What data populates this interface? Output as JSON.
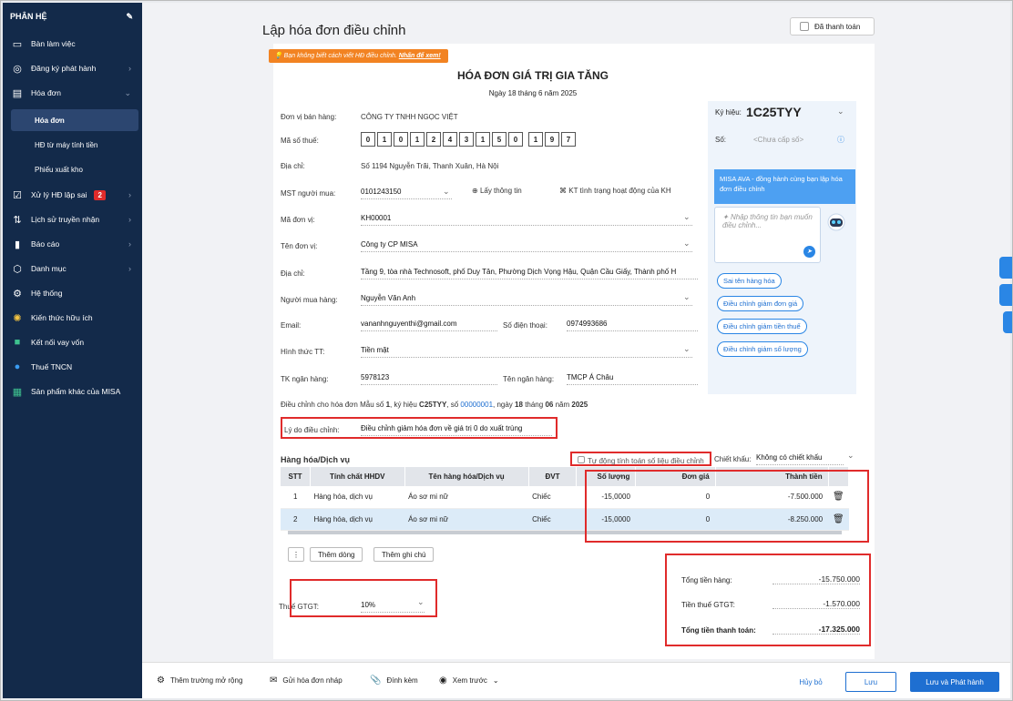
{
  "sidebar": {
    "header": "PHÂN HỆ",
    "items": [
      {
        "label": "Bàn làm việc",
        "icon": "desk-icon"
      },
      {
        "label": "Đăng ký phát hành",
        "icon": "register-icon"
      },
      {
        "label": "Hóa đơn",
        "icon": "invoice-icon"
      },
      {
        "label": "Hóa đơn",
        "icon": ""
      },
      {
        "label": "HĐ từ máy tính tiền",
        "icon": ""
      },
      {
        "label": "Phiếu xuất kho",
        "icon": ""
      },
      {
        "label": "Xử lý HĐ lập sai",
        "icon": "fix-icon",
        "badge": "2"
      },
      {
        "label": "Lịch sử truyền nhận",
        "icon": "history-icon"
      },
      {
        "label": "Báo cáo",
        "icon": "report-icon"
      },
      {
        "label": "Danh mục",
        "icon": "category-icon"
      },
      {
        "label": "Hệ thống",
        "icon": "settings-icon"
      },
      {
        "label": "Kiến thức hữu ích",
        "icon": "bulb-icon"
      },
      {
        "label": "Kết nối vay vốn",
        "icon": "loan-icon"
      },
      {
        "label": "Thuế TNCN",
        "icon": "tax-icon"
      },
      {
        "label": "Sản phẩm khác của MISA",
        "icon": "apps-icon"
      }
    ]
  },
  "header": {
    "title": "Lập hóa đơn điều chỉnh",
    "paid_label": "Đã thanh toán"
  },
  "tip": {
    "text": "Bạn không biết cách viết HĐ điều chỉnh.",
    "link": "Nhấn để xem!"
  },
  "doc": {
    "title": "HÓA ĐƠN GIÁ TRỊ GIA TĂNG",
    "date": "Ngày 18 tháng 6 năm 2025"
  },
  "seller": {
    "unit_label": "Đơn vị bán hàng:",
    "unit": "CÔNG TY TNHH NGỌC VIỆT",
    "tax_label": "Mã số thuế:",
    "tax_digits": [
      "0",
      "1",
      "0",
      "1",
      "2",
      "4",
      "3",
      "1",
      "5",
      "0",
      "1",
      "9",
      "7"
    ],
    "addr_label": "Địa chỉ:",
    "addr": "Số 1194 Nguyễn Trãi, Thanh Xuân, Hà Nội"
  },
  "buyer": {
    "mst_label": "MST người mua:",
    "mst": "0101243150",
    "lookup": "Lấy thông tin",
    "check": "KT tình trạng hoạt động của KH",
    "unitcode_label": "Mã đơn vị:",
    "unitcode": "KH00001",
    "unitname_label": "Tên đơn vị:",
    "unitname": "Công ty CP MISA",
    "addr_label": "Địa chỉ:",
    "addr": "Tầng 9, tòa nhà Technosoft, phố Duy Tân, Phường Dịch Vọng Hậu, Quận Cầu Giấy, Thành phố H",
    "person_label": "Người mua hàng:",
    "person": "Nguyễn Văn Anh",
    "email_label": "Email:",
    "email": "vananhnguyenthi@gmail.com",
    "phone_label": "Số điện thoại:",
    "phone": "0974993686",
    "pay_label": "Hình thức TT:",
    "pay": "Tiền mặt",
    "bank_label": "TK ngân hàng:",
    "bank": "5978123",
    "bankname_label": "Tên ngân hàng:",
    "bankname": "TMCP Á Châu"
  },
  "adjust": {
    "prefix": "Điều chỉnh cho hóa đơn Mẫu số",
    "form": "1",
    "symbol_label": ", ký hiệu",
    "symbol": "C25TYY",
    "no_label": ", số",
    "no": "00000001",
    "date_mid": ", ngày",
    "day": "18",
    "month_label": "tháng",
    "month": "06",
    "year_label": "năm",
    "year": "2025",
    "reason_label": "Lý do điều chỉnh:",
    "reason": "Điều chỉnh giảm hóa đơn về giá trị 0 do xuất trùng"
  },
  "right": {
    "ky_label": "Ký hiệu:",
    "ky_value": "1C25TYY",
    "so_label": "Số:",
    "so_value": "<Chưa cấp số>",
    "ava_text": "MISA AVA - đồng hành cùng bạn lập hóa đơn điều chỉnh",
    "chat_placeholder": "Nhập thông tin bạn muốn điều chỉnh...",
    "chips": [
      "Sai tên hàng hóa",
      "Điều chỉnh giảm đơn giá",
      "Điều chỉnh giảm tiền thuế",
      "Điều chỉnh giảm số lượng"
    ]
  },
  "goods": {
    "title": "Hàng hóa/Dịch vụ",
    "auto_calc": "Tự động tính toán số liệu điều chỉnh",
    "discount_label": "Chiết khấu:",
    "discount": "Không có chiết khấu",
    "columns": [
      "STT",
      "Tính chất HHDV",
      "Tên hàng hóa/Dịch vụ",
      "ĐVT",
      "Số lượng",
      "Đơn giá",
      "Thành tiền"
    ],
    "rows": [
      [
        "1",
        "Hàng hóa, dịch vụ",
        "Áo sơ mi nữ",
        "Chiếc",
        "-15,0000",
        "0",
        "-7.500.000"
      ],
      [
        "2",
        "Hàng hóa, dịch vụ",
        "Áo sơ mi nữ",
        "Chiếc",
        "-15,0000",
        "0",
        "-8.250.000"
      ]
    ],
    "add_row": "Thêm dòng",
    "add_note": "Thêm ghi chú"
  },
  "tax": {
    "label": "Thuế GTGT:",
    "value": "10%"
  },
  "totals": {
    "goods_label": "Tổng tiền hàng:",
    "goods": "-15.750.000",
    "vat_label": "Tiền thuế GTGT:",
    "vat": "-1.570.000",
    "pay_label": "Tổng tiền thanh toán:",
    "pay": "-17.325.000"
  },
  "footer": {
    "extend": "Thêm trường mở rộng",
    "draft": "Gửi hóa đơn nháp",
    "attach": "Đính kèm",
    "preview": "Xem trước",
    "cancel": "Hủy bỏ",
    "save": "Lưu",
    "save_publish": "Lưu và Phát hành"
  }
}
